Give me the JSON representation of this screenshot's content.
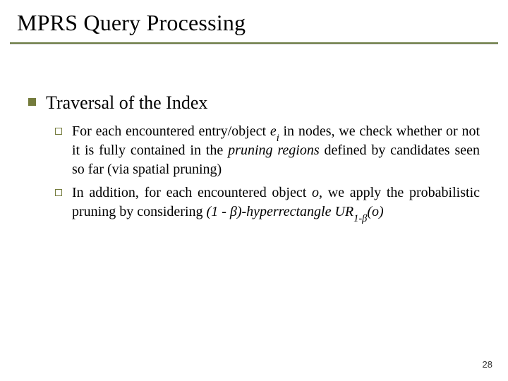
{
  "title": "MPRS Query Processing",
  "section": {
    "heading": "Traversal of the Index",
    "items": [
      {
        "pre": "For each encountered entry/object ",
        "var": "e",
        "sub": "i",
        "mid": " in nodes, we check whether or not it is fully contained in the ",
        "ital1": "pruning regions",
        "post": " defined by candidates seen so far (via spatial pruning)"
      },
      {
        "pre": "In addition, for each encountered object ",
        "ovar": "o",
        "mid1": ", we apply the probabilistic pruning by considering ",
        "hyper_prefix": "(1 - ",
        "beta1": "β",
        "hyper_mid": ")-hyperrectangle UR",
        "sub_prefix": "1-",
        "sub_beta": "β",
        "open_paren": "(",
        "ovar2": "o",
        "close_paren": ")"
      }
    ]
  },
  "page_number": "28"
}
